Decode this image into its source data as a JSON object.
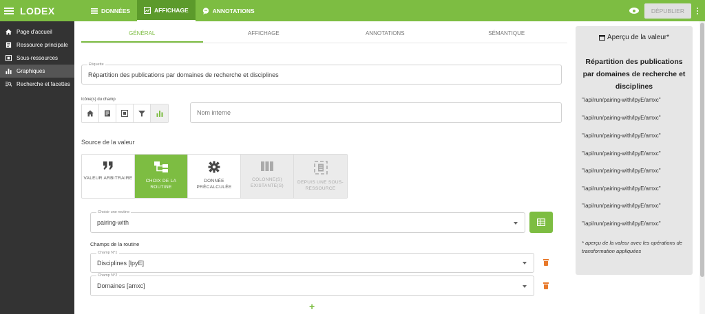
{
  "app": {
    "logo": "LODEX"
  },
  "topnav": [
    {
      "label": "DONNÉES",
      "icon": "list-icon"
    },
    {
      "label": "AFFICHAGE",
      "icon": "display-icon",
      "active": true
    },
    {
      "label": "ANNOTATIONS",
      "icon": "comment-icon"
    }
  ],
  "topright": {
    "publish_label": "DÉPUBLIER"
  },
  "sidebar": {
    "items": [
      {
        "label": "Page d'accueil",
        "icon": "home-icon"
      },
      {
        "label": "Ressource principale",
        "icon": "document-icon"
      },
      {
        "label": "Sous-ressources",
        "icon": "subresource-icon"
      },
      {
        "label": "Graphiques",
        "icon": "bar-chart-icon",
        "active": true
      },
      {
        "label": "Recherche et facettes",
        "icon": "search-list-icon"
      }
    ]
  },
  "tabs": [
    "GÉNÉRAL",
    "AFFICHAGE",
    "ANNOTATIONS",
    "SÉMANTIQUE"
  ],
  "form": {
    "etiquette_label": "Étiquette",
    "etiquette_value": "Répartition des publications par domaines de recherche et disciplines",
    "icons_label": "Icône(s) du champ",
    "nom_interne_placeholder": "Nom interne",
    "source_title": "Source de la valeur",
    "sources": [
      {
        "label": "VALEUR ARBITRAIRE",
        "icon": "quote-icon",
        "state": "normal"
      },
      {
        "label": "CHOIX DE LA ROUTINE",
        "icon": "routine-icon",
        "state": "selected"
      },
      {
        "label": "DONNÉE PRÉCALCULÉE",
        "icon": "gear-icon",
        "state": "normal"
      },
      {
        "label": "COLONNE(S) EXISTANTE(S)",
        "icon": "columns-icon",
        "state": "disabled"
      },
      {
        "label": "DEPUIS UNE SOUS-RESSOURCE",
        "icon": "subresource-icon",
        "state": "disabled"
      }
    ],
    "routine_label": "Choisir une routine",
    "routine_value": "pairing-with",
    "champs_title": "Champs de la routine",
    "champ1_label": "Champ N°1",
    "champ1_value": "Disciplines [lpyE]",
    "champ2_label": "Champ N°2",
    "champ2_value": "Domaines [amxc]",
    "add_symbol": "+"
  },
  "preview": {
    "title": "Aperçu de la valeur*",
    "heading": "Répartition des publications par domaines de recherche et disciplines",
    "values": [
      "\"/api/run/pairing-with/lpyE/amxc\"",
      "\"/api/run/pairing-with/lpyE/amxc\"",
      "\"/api/run/pairing-with/lpyE/amxc\"",
      "\"/api/run/pairing-with/lpyE/amxc\"",
      "\"/api/run/pairing-with/lpyE/amxc\"",
      "\"/api/run/pairing-with/lpyE/amxc\"",
      "\"/api/run/pairing-with/lpyE/amxc\"",
      "\"/api/run/pairing-with/lpyE/amxc\""
    ],
    "note": "* aperçu de la valeur avec les opérations de transformation appliquées"
  },
  "colors": {
    "accent": "#7dbd42",
    "sidebar": "#333333",
    "danger": "#e8792b"
  }
}
